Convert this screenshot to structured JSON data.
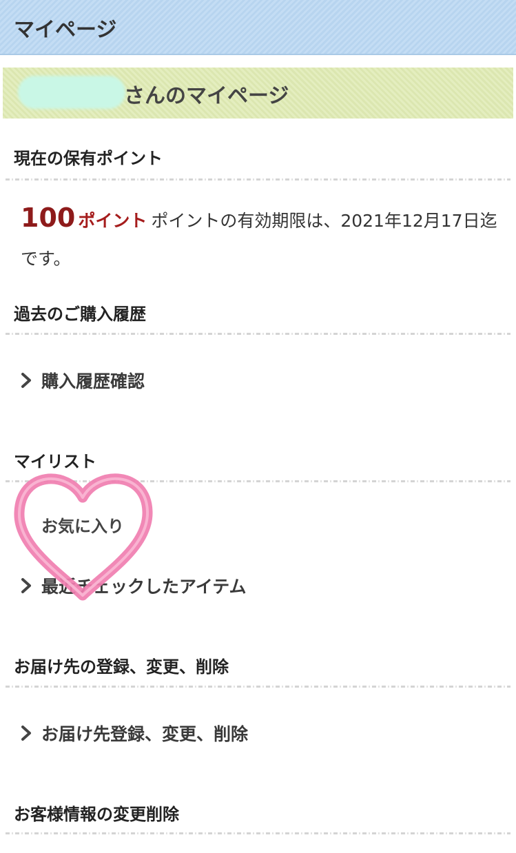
{
  "header": {
    "title": "マイページ"
  },
  "user_banner": {
    "suffix": "さんのマイページ"
  },
  "points": {
    "heading": "現在の保有ポイント",
    "value": "100",
    "unit": "ポイント",
    "note": "ポイントの有効期限は、2021年12月17日迄です。"
  },
  "purchase_history": {
    "heading": "過去のご購入履歴",
    "link": "購入履歴確認"
  },
  "mylist": {
    "heading": "マイリスト",
    "favorites_label": "お気に入り",
    "recent_link": "最近チェックしたアイテム"
  },
  "shipping": {
    "heading": "お届け先の登録、変更、削除",
    "link": "お届け先登録、変更、削除"
  },
  "customer_info": {
    "heading": "お客様情報の変更削除"
  },
  "colors": {
    "header_bg": "#c4ddf4",
    "banner_bg": "#e4eebf",
    "points_value": "#8e1b1b",
    "heart_stroke": "#f07eb0"
  }
}
